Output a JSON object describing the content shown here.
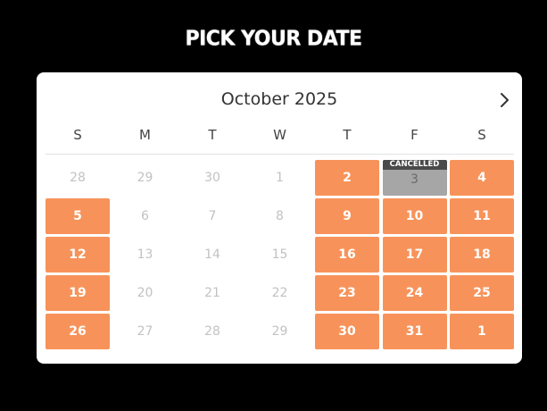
{
  "page": {
    "title": "PICK YOUR DATE"
  },
  "calendar": {
    "month_label": "October 2025",
    "next_icon": "chevron-right-icon",
    "weekdays": [
      "S",
      "M",
      "T",
      "W",
      "T",
      "F",
      "S"
    ],
    "badge_label": "CANCELLED",
    "days": [
      {
        "label": "28",
        "state": "muted"
      },
      {
        "label": "29",
        "state": "muted"
      },
      {
        "label": "30",
        "state": "muted"
      },
      {
        "label": "1",
        "state": "muted"
      },
      {
        "label": "2",
        "state": "available"
      },
      {
        "label": "3",
        "state": "cancelled"
      },
      {
        "label": "4",
        "state": "available"
      },
      {
        "label": "5",
        "state": "available"
      },
      {
        "label": "6",
        "state": "muted"
      },
      {
        "label": "7",
        "state": "muted"
      },
      {
        "label": "8",
        "state": "muted"
      },
      {
        "label": "9",
        "state": "available"
      },
      {
        "label": "10",
        "state": "available"
      },
      {
        "label": "11",
        "state": "available"
      },
      {
        "label": "12",
        "state": "available"
      },
      {
        "label": "13",
        "state": "muted"
      },
      {
        "label": "14",
        "state": "muted"
      },
      {
        "label": "15",
        "state": "muted"
      },
      {
        "label": "16",
        "state": "available"
      },
      {
        "label": "17",
        "state": "available"
      },
      {
        "label": "18",
        "state": "available"
      },
      {
        "label": "19",
        "state": "available"
      },
      {
        "label": "20",
        "state": "muted"
      },
      {
        "label": "21",
        "state": "muted"
      },
      {
        "label": "22",
        "state": "muted"
      },
      {
        "label": "23",
        "state": "available"
      },
      {
        "label": "24",
        "state": "available"
      },
      {
        "label": "25",
        "state": "available"
      },
      {
        "label": "26",
        "state": "available"
      },
      {
        "label": "27",
        "state": "muted"
      },
      {
        "label": "28",
        "state": "muted"
      },
      {
        "label": "29",
        "state": "muted"
      },
      {
        "label": "30",
        "state": "available"
      },
      {
        "label": "31",
        "state": "available"
      },
      {
        "label": "1",
        "state": "available"
      }
    ]
  },
  "colors": {
    "background": "#000000",
    "card": "#ffffff",
    "available": "#f7935a",
    "cancelled": "#a6a6a6",
    "badge": "#4a4a4a",
    "muted_text": "#c2c2c2"
  }
}
